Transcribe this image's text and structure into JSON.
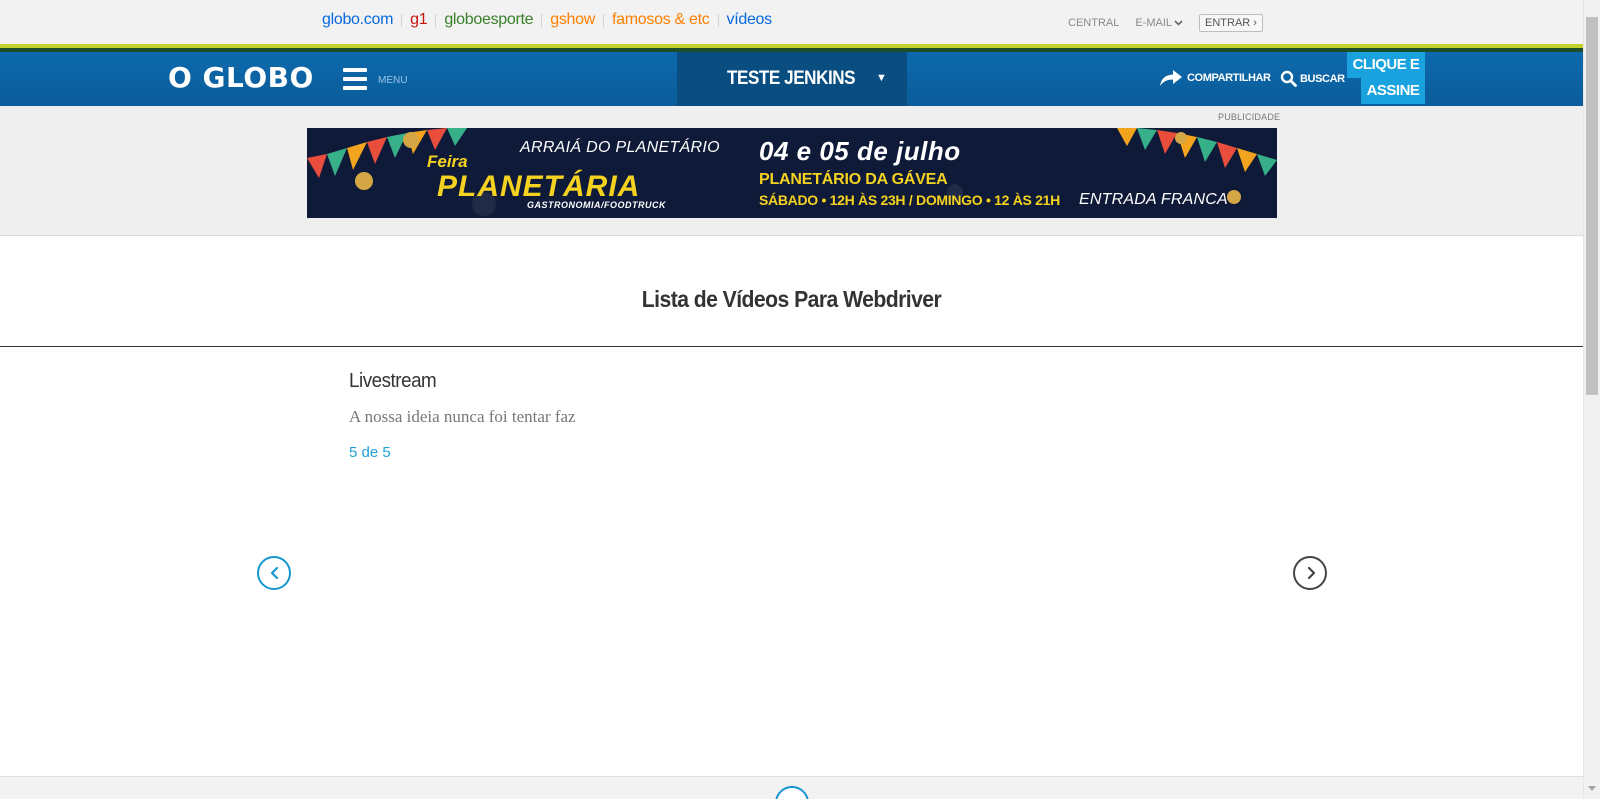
{
  "globo_bar": {
    "links": [
      {
        "label": "globo.com",
        "color": "#0669de"
      },
      {
        "label": "g1",
        "color": "#c4170c"
      },
      {
        "label": "globoesporte",
        "color": "#39802a"
      },
      {
        "label": "gshow",
        "color": "#ff7f00"
      },
      {
        "label": "famosos & etc",
        "color": "#ff7f00"
      },
      {
        "label": "vídeos",
        "color": "#0669de"
      }
    ],
    "central": "CENTRAL",
    "email": "E-MAIL",
    "entrar": "ENTRAR ›"
  },
  "header": {
    "logo": "O GLOBO",
    "menu_label": "MENU",
    "section_title": "TESTE JENKINS",
    "section_caret": "▼",
    "share_label": "COMPARTILHAR",
    "search_label": "BUSCAR",
    "subscribe_line1": "CLIQUE E",
    "subscribe_line2": "ASSINE",
    "colors": {
      "bar": "#0a5c99",
      "section": "#0a4d80",
      "subscribe": "#19a2dd",
      "stripe_yellow": "#c5d22b",
      "stripe_green": "#1d4e29"
    }
  },
  "ad": {
    "label": "PUBLICIDADE",
    "arraia": "ARRAIÁ DO PLANETÁRIO",
    "feira": "Feira",
    "planetaria": "PLANETÁRIA",
    "gastronomia": "GASTRONOMIA/FOODTRUCK",
    "date": "04 e 05 de julho",
    "place": "PLANETÁRIO DA GÁVEA",
    "hours": "SÁBADO • 12H ÀS 23H / DOMINGO • 12 ÀS 21H",
    "entrada": "ENTRADA FRANCA"
  },
  "main": {
    "page_title": "Lista de Vídeos Para Webdriver",
    "video_title": "Livestream",
    "video_description": "A nossa ideia nunca foi tentar faz",
    "video_count": "5 de 5"
  },
  "icons": {
    "share": "share-arrow-icon",
    "search": "search-icon",
    "menu": "hamburger-icon",
    "prev": "chevron-left-icon",
    "next": "chevron-right-icon"
  }
}
